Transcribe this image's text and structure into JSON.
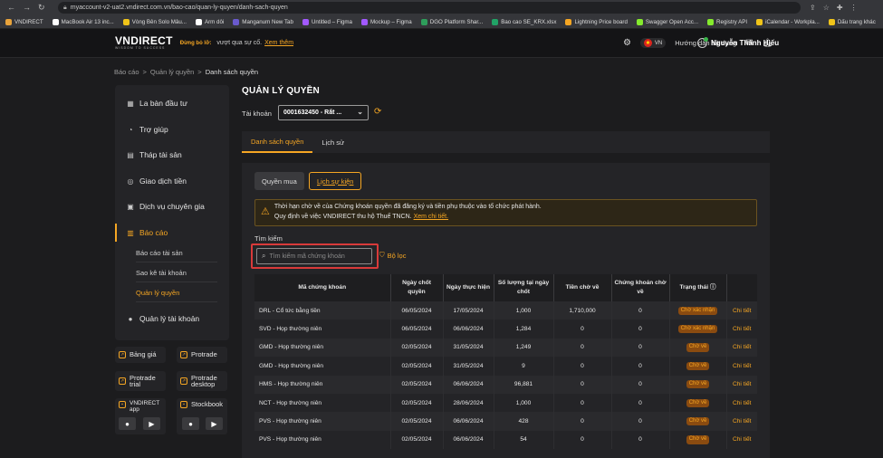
{
  "browser": {
    "url": "myaccount-v2-uat2.vndirect.com.vn/bao-cao/quan-ly-quyen/danh-sach-quyen",
    "bookmarks": [
      {
        "label": "VNDIRECT",
        "color": "#e8a33b"
      },
      {
        "label": "MacBook Air 13 inc...",
        "color": "#ffffff"
      },
      {
        "label": "Vòng Bên Solo Mâu...",
        "color": "#f0c419"
      },
      {
        "label": "Arm dôi",
        "color": "#ffffff"
      },
      {
        "label": "Manganum New Tab",
        "color": "#6a5acd"
      },
      {
        "label": "Untitled – Figma",
        "color": "#a259ff"
      },
      {
        "label": "Mockup – Figma",
        "color": "#a259ff"
      },
      {
        "label": "DGO Platform Shar...",
        "color": "#2e9e5b"
      },
      {
        "label": "Bao cao SE_KRX.xlsx",
        "color": "#21a366"
      },
      {
        "label": "Lightning Price board",
        "color": "#f5a623"
      },
      {
        "label": "Swagger Open Acc...",
        "color": "#85ea2d"
      },
      {
        "label": "Registry API",
        "color": "#85ea2d"
      },
      {
        "label": "iCalendar - Workpla...",
        "color": "#f0c419"
      },
      {
        "label": "Dấu trang khác",
        "color": "#f0c419"
      }
    ]
  },
  "header": {
    "logo": "VNDIRECT",
    "logo_sub": "WISDOM TO SUCCESS",
    "notice_tag": "Đừng bỏ lỡ:",
    "notice_text": "vượt qua sự cố.",
    "notice_link": "Xem thêm",
    "lang": "VN",
    "guide": "Hướng dẫn sử dụng",
    "user_name": "Nguyễn Thành Hiếu"
  },
  "breadcrumb": [
    "Báo cáo",
    "Quản lý quyền",
    "Danh sách quyền"
  ],
  "sidebar": {
    "items": [
      {
        "label": "La bàn đầu tư",
        "icon": "grid-icon"
      },
      {
        "label": "Trợ giúp",
        "icon": "help-icon"
      },
      {
        "label": "Tháp tài sản",
        "icon": "tower-icon"
      },
      {
        "label": "Giao dịch tiền",
        "icon": "money-icon"
      },
      {
        "label": "Dịch vụ chuyên gia",
        "icon": "expert-icon"
      },
      {
        "label": "Báo cáo",
        "icon": "report-icon"
      },
      {
        "label": "Quản lý tài khoản",
        "icon": "account-icon"
      }
    ],
    "sub_items": [
      "Báo cáo tài sản",
      "Sao kê tài khoản",
      "Quản lý quyền"
    ]
  },
  "apps": {
    "bang_gia": "Bảng giá",
    "protrade": "Protrade",
    "protrade_trial_1": "Protrade",
    "protrade_trial_2": "trial",
    "protrade_desktop_1": "Protrade",
    "protrade_desktop_2": "desktop",
    "vndirect_app_1": "VNDIRECT",
    "vndirect_app_2": "app",
    "stockbook": "Stockbook"
  },
  "main": {
    "title": "QUẢN LÝ QUYỀN",
    "account_label": "Tài khoản",
    "account_value": "0001632450 - Rất ...",
    "tabs": [
      "Danh sách quyền",
      "Lịch sử"
    ],
    "segments": [
      "Quyền mua",
      "Lịch sự kiện"
    ],
    "warning_line1": "Thời hạn chờ về của Chứng khoán quyền đã đăng ký và tiền phụ thuộc vào tổ chức phát hành.",
    "warning_line2": "Quy định về việc VNDIRECT thu hộ Thuế TNCN.",
    "warning_link": "Xem chi tiết.",
    "search_label": "Tìm kiếm",
    "search_placeholder": "Tìm kiếm mã chứng khoán",
    "filter_label": "Bộ lọc"
  },
  "table": {
    "headers": [
      "Mã chứng khoán",
      "Ngày chốt quyền",
      "Ngày thực hiện",
      "Số lượng tại ngày chốt",
      "Tiền chờ về",
      "Chứng khoán chờ về",
      "Trạng thái",
      ""
    ],
    "rows": [
      [
        "DRL - Cổ tức bằng tiền",
        "06/05/2024",
        "17/05/2024",
        "1,000",
        "1,710,000",
        "0",
        "Chờ xác nhận",
        "Chi tiết"
      ],
      [
        "SVD - Họp thường niên",
        "06/05/2024",
        "06/06/2024",
        "1,284",
        "0",
        "0",
        "Chờ xác nhận",
        "Chi tiết"
      ],
      [
        "GMD - Họp thường niên",
        "02/05/2024",
        "31/05/2024",
        "1,249",
        "0",
        "0",
        "Chờ về",
        "Chi tiết"
      ],
      [
        "GMD - Họp thường niên",
        "02/05/2024",
        "31/05/2024",
        "9",
        "0",
        "0",
        "Chờ về",
        "Chi tiết"
      ],
      [
        "HMS - Họp thường niên",
        "02/05/2024",
        "06/06/2024",
        "96,881",
        "0",
        "0",
        "Chờ về",
        "Chi tiết"
      ],
      [
        "NCT - Họp thường niên",
        "02/05/2024",
        "28/06/2024",
        "1,000",
        "0",
        "0",
        "Chờ về",
        "Chi tiết"
      ],
      [
        "PVS - Họp thường niên",
        "02/05/2024",
        "06/06/2024",
        "428",
        "0",
        "0",
        "Chờ về",
        "Chi tiết"
      ],
      [
        "PVS - Họp thường niên",
        "02/05/2024",
        "06/06/2024",
        "54",
        "0",
        "0",
        "Chờ về",
        "Chi tiết"
      ]
    ]
  }
}
